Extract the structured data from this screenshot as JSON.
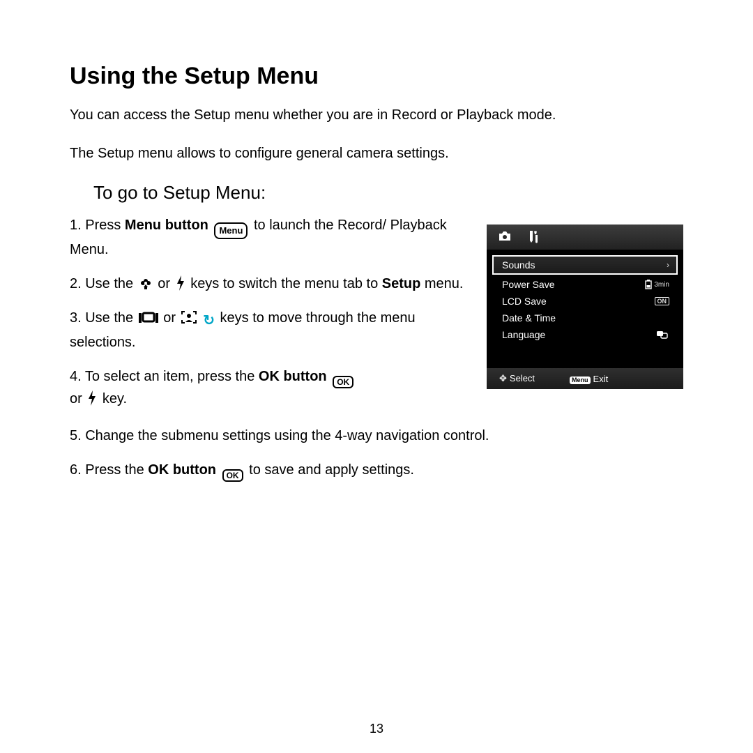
{
  "title": "Using the Setup Menu",
  "intro": [
    "You can access the Setup menu whether you are in Record or Playback mode.",
    "The Setup menu allows to configure general camera settings."
  ],
  "subhead": "To go to Setup Menu:",
  "steps": {
    "s1_a": "1.  Press ",
    "s1_b": "Menu button",
    "s1_c": " to launch the Record/ Playback Menu.",
    "s2_a": "2.  Use the ",
    "s2_b": " or ",
    "s2_c": " keys to switch the menu tab to ",
    "s2_d": "Setup",
    "s2_e": " menu.",
    "s3_a": "3.  Use the ",
    "s3_b": " or ",
    "s3_c": " keys to move through the menu selections.",
    "s4_a": "4.  To select an item, press the ",
    "s4_b": "OK button",
    "s4_c": " or ",
    "s4_d": " key.",
    "s5": "5.  Change the submenu settings using the 4-way navigation control.",
    "s6_a": "6.  Press the ",
    "s6_b": "OK button",
    "s6_c": " to save and apply settings."
  },
  "icons": {
    "menu": "Menu",
    "ok": "OK"
  },
  "lcd": {
    "rows": [
      {
        "label": "Sounds",
        "value_icon": "chevron"
      },
      {
        "label": "Power Save",
        "value": "3min",
        "value_icon": "battery"
      },
      {
        "label": "LCD Save",
        "value": "ON"
      },
      {
        "label": "Date & Time",
        "value": ""
      },
      {
        "label": "Language",
        "value_icon": "globe"
      }
    ],
    "footer": {
      "select": "Select",
      "exit": "Exit",
      "menu_label": "Menu"
    }
  },
  "page_number": "13"
}
